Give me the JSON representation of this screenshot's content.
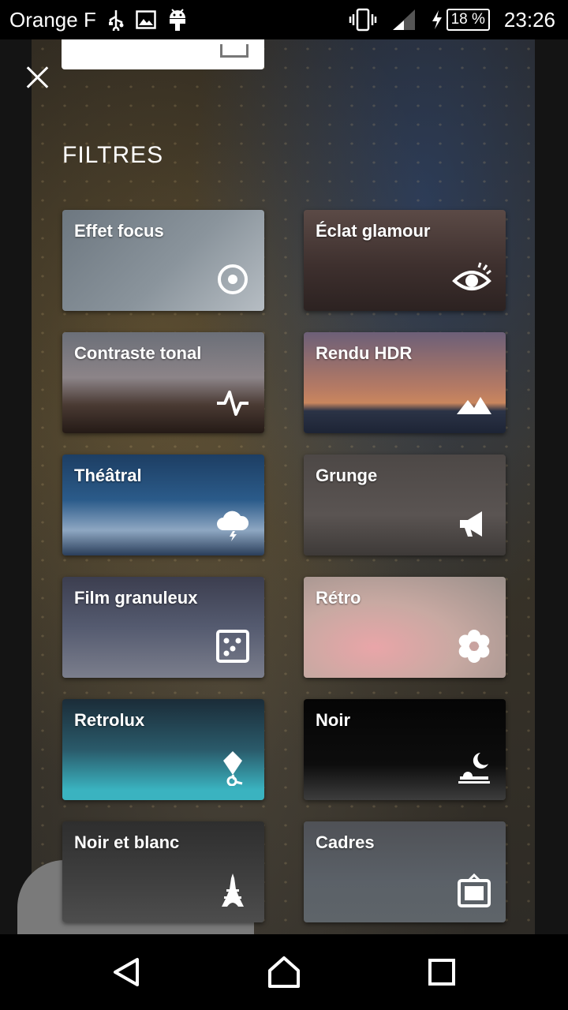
{
  "status_bar": {
    "carrier": "Orange F",
    "battery_text": "18 %",
    "time": "23:26",
    "icons": [
      "usb-icon",
      "image-icon",
      "android-icon",
      "vibrate-icon",
      "signal-icon",
      "charging-icon",
      "battery-icon"
    ]
  },
  "header": {
    "close_icon": "close-icon",
    "section_title": "FILTRES"
  },
  "filters": [
    {
      "label": "Effet focus",
      "icon": "focus-target-icon"
    },
    {
      "label": "Éclat glamour",
      "icon": "eye-icon"
    },
    {
      "label": "Contraste tonal",
      "icon": "pulse-icon"
    },
    {
      "label": "Rendu HDR",
      "icon": "mountains-icon"
    },
    {
      "label": "Théâtral",
      "icon": "storm-cloud-icon"
    },
    {
      "label": "Grunge",
      "icon": "megaphone-icon"
    },
    {
      "label": "Film granuleux",
      "icon": "dice-icon"
    },
    {
      "label": "Rétro",
      "icon": "flower-icon"
    },
    {
      "label": "Retrolux",
      "icon": "balloon-icon"
    },
    {
      "label": "Noir",
      "icon": "moon-icon"
    },
    {
      "label": "Noir et blanc",
      "icon": "eiffel-tower-icon"
    },
    {
      "label": "Cadres",
      "icon": "frame-icon"
    }
  ],
  "nav_bar": {
    "back_icon": "back-icon",
    "home_icon": "home-icon",
    "recents_icon": "recents-icon"
  }
}
